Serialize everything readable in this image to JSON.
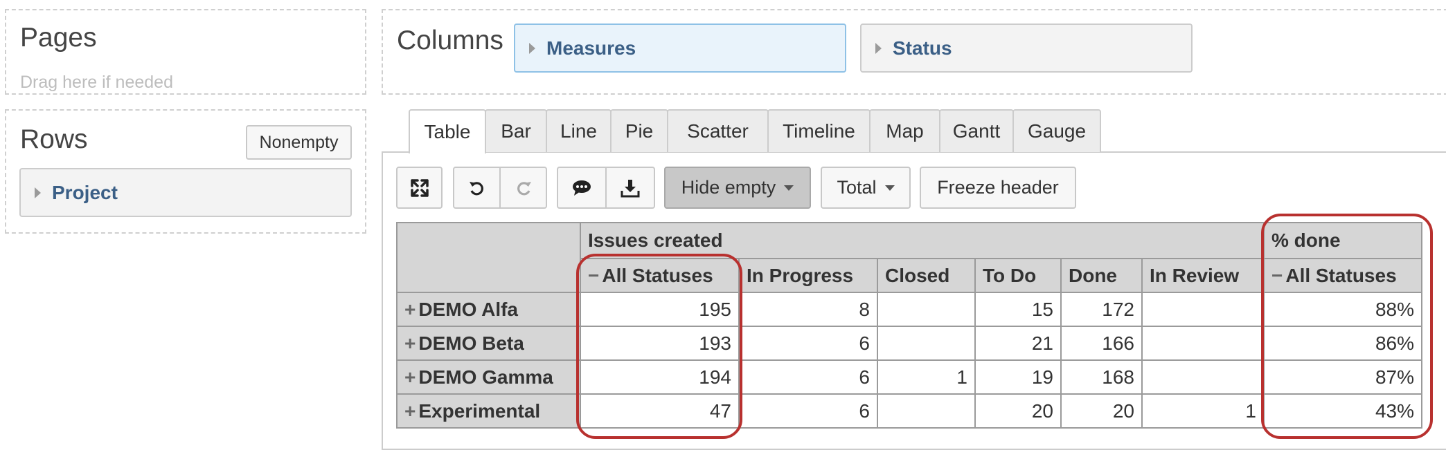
{
  "pages": {
    "title": "Pages",
    "hint": "Drag here if needed"
  },
  "columns": {
    "title": "Columns",
    "chips": [
      "Measures",
      "Status"
    ]
  },
  "rows": {
    "title": "Rows",
    "nonempty_label": "Nonempty",
    "chips": [
      "Project"
    ]
  },
  "tabs": [
    "Table",
    "Bar",
    "Line",
    "Pie",
    "Scatter",
    "Timeline",
    "Map",
    "Gantt",
    "Gauge"
  ],
  "toolbar": {
    "hide_empty_label": "Hide empty",
    "total_label": "Total",
    "freeze_label": "Freeze header",
    "icons": [
      "fullscreen-icon",
      "undo-icon",
      "redo-icon",
      "comment-icon",
      "download-icon"
    ]
  },
  "table": {
    "group_headers": {
      "issues_created": "Issues created",
      "pct_done": "% done"
    },
    "columns": [
      "All Statuses",
      "In Progress",
      "Closed",
      "To Do",
      "Done",
      "In Review",
      "All Statuses"
    ],
    "rows": [
      {
        "name": "DEMO Alfa",
        "values": [
          "195",
          "8",
          "",
          "15",
          "172",
          "",
          "88%"
        ]
      },
      {
        "name": "DEMO Beta",
        "values": [
          "193",
          "6",
          "",
          "21",
          "166",
          "",
          "86%"
        ]
      },
      {
        "name": "DEMO Gamma",
        "values": [
          "194",
          "6",
          "1",
          "19",
          "168",
          "",
          "87%"
        ]
      },
      {
        "name": "Experimental",
        "values": [
          "47",
          "6",
          "",
          "20",
          "20",
          "1",
          "43%"
        ]
      }
    ]
  },
  "colors": {
    "highlight": "#b8312f",
    "chip_text": "#3b5f86"
  }
}
